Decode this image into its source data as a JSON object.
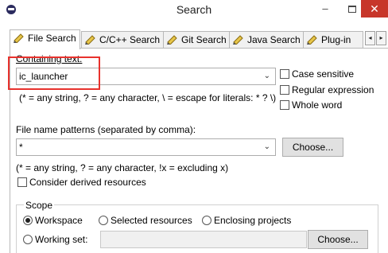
{
  "window": {
    "title": "Search",
    "minimize": "–",
    "close": "✕"
  },
  "tabs": [
    {
      "label": "File Search",
      "icon": "file-search-icon",
      "active": true
    },
    {
      "label": "C/C++ Search",
      "icon": "cpp-search-icon",
      "active": false
    },
    {
      "label": "Git Search",
      "icon": "git-search-icon",
      "active": false
    },
    {
      "label": "Java Search",
      "icon": "java-search-icon",
      "active": false
    },
    {
      "label": "Plug-in",
      "icon": "plugin-search-icon",
      "active": false
    }
  ],
  "tab_scroll": {
    "left": "◂",
    "right": "▸"
  },
  "containing_text": {
    "label": "Containing text:",
    "value": "ic_launcher",
    "hint": "(* = any string, ? = any character, \\ = escape for literals: * ? \\)"
  },
  "options": {
    "case_sensitive": "Case sensitive",
    "case_sensitive_checked": false,
    "regular_expression": "Regular expression",
    "regular_expression_checked": false,
    "whole_word": "Whole word",
    "whole_word_checked": false
  },
  "file_patterns": {
    "label": "File name patterns (separated by comma):",
    "value": "*",
    "choose": "Choose...",
    "hint": "(* = any string, ? = any character, !x = excluding x)"
  },
  "derived": {
    "label": "Consider derived resources",
    "checked": false
  },
  "scope": {
    "title": "Scope",
    "workspace": "Workspace",
    "selected_resources": "Selected resources",
    "enclosing_projects": "Enclosing projects",
    "working_set": "Working set:",
    "choose": "Choose...",
    "selected": "workspace"
  },
  "colors": {
    "highlight": "#e8322d",
    "close_button": "#c7362a"
  }
}
